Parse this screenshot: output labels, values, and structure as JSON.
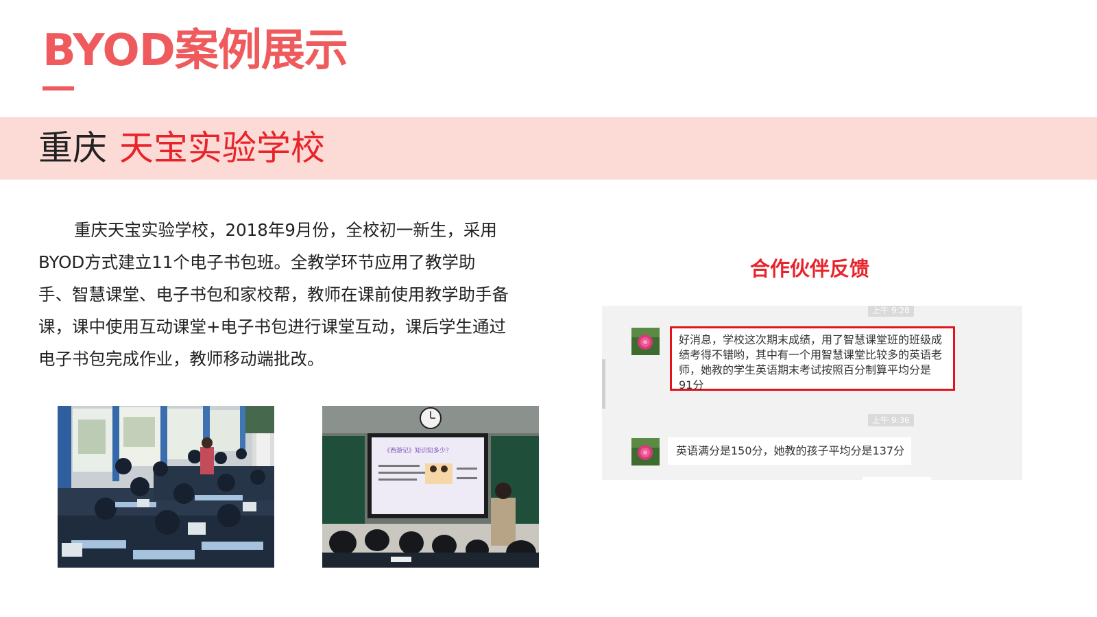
{
  "slide": {
    "title": "BYOD案例展示"
  },
  "banner": {
    "city": "重庆",
    "school": "天宝实验学校"
  },
  "description": "重庆天宝实验学校，2018年9月份，全校初一新生，采用BYOD方式建立11个电子书包班。全教学环节应用了教学助手、智慧课堂、电子书包和家校帮，教师在课前使用教学助手备课，课中使用互动课堂+电子书包进行课堂互动，课后学生通过电子书包完成作业，教师移动端批改。",
  "photos": {
    "lecture_screen_text": "《西游记》知识知多少？"
  },
  "feedback": {
    "title": "合作伙伴反馈",
    "messages": [
      {
        "time": "上午 9:28",
        "text": "好消息，学校这次期末成绩，用了智慧课堂班的班级成绩考得不错哟，其中有一个用智慧课堂比较多的英语老师，她教的学生英语期末考试按照百分制算平均分是91分"
      },
      {
        "time": "上午 9:36",
        "text": "英语满分是150分，她教的孩子平均分是137分"
      }
    ]
  },
  "colors": {
    "title": "#ef5a5d",
    "banner_bg": "#fcdbd6",
    "school_name": "#e8232a",
    "feedback_title": "#e8232a",
    "highlight_border": "#e2141b",
    "chat_bg": "#f2f2f2"
  }
}
